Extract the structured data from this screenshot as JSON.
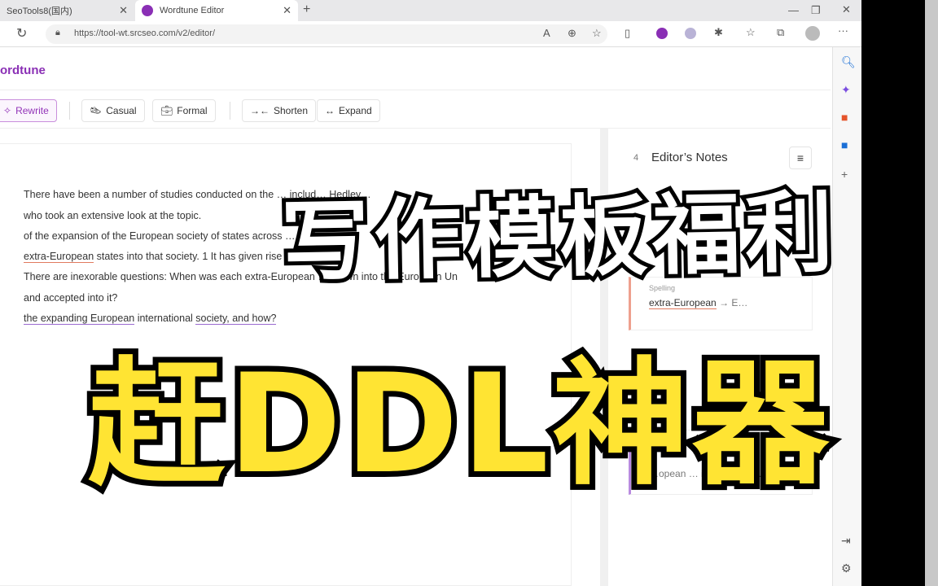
{
  "browser": {
    "tabs": [
      {
        "title": "SeoTools8(国内)"
      },
      {
        "title": "Wordtune Editor"
      }
    ],
    "url": "https://tool-wt.srcseo.com/v2/editor/"
  },
  "app": {
    "logo": "ordtune"
  },
  "toolbar": {
    "rewrite": "Rewrite",
    "casual": "Casual",
    "formal": "Formal",
    "shorten": "Shorten",
    "expand": "Expand"
  },
  "editor": {
    "lines": [
      "There have been a number of studies conducted on the … includ… Hedley…",
      "who took an extensive look at the topic.",
      "of the expansion of the European society of states across … e",
      "extra-European states into that society. 1 It has given rise … ging a",
      "There are inexorable questions: When was each extra-European … drawn into the European Un",
      "and accepted into it?",
      "the expanding European international society, and how?"
    ]
  },
  "notes": {
    "count": "4",
    "title": "Editor’s Notes",
    "cards": [
      {
        "type": "Spelling",
        "from": "extra-European",
        "to": "E…"
      },
      {
        "text": "…opean … internationa…"
      }
    ]
  },
  "overlay": {
    "line1": "写作模板福利",
    "line2": "赶DDL神器"
  },
  "colors": {
    "brand": "#8a2fb5",
    "overlay_yellow": "#ffe433"
  }
}
